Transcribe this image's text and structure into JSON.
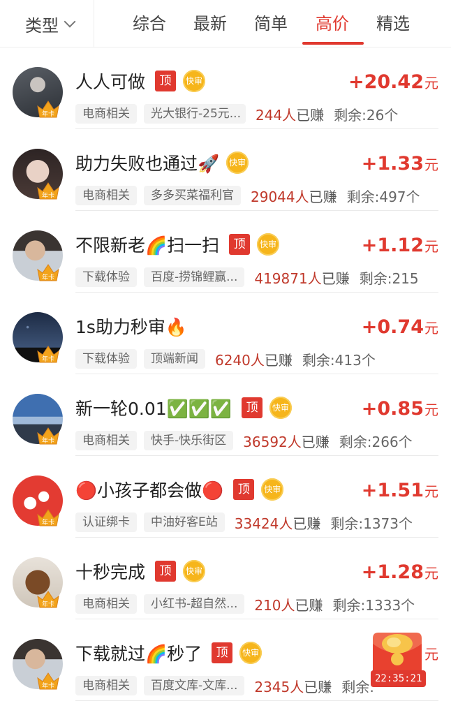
{
  "topbar": {
    "type_label": "类型",
    "tabs": [
      {
        "label": "综合"
      },
      {
        "label": "最新"
      },
      {
        "label": "简单"
      },
      {
        "label": "高价",
        "active": true
      },
      {
        "label": "精选"
      }
    ]
  },
  "accent_color": "#e0392f",
  "tasks": [
    {
      "title": "人人可做",
      "emoji": "",
      "top_badge": "顶",
      "fast_badge": "快审",
      "price": "+20.42",
      "unit": "元",
      "tag1": "电商相关",
      "tag2": "光大银行-25元...",
      "earned_count": "244人",
      "earned_suffix": "已赚",
      "remaining": "剩余:26个",
      "avatar": "person-dark-photo",
      "crown_label": "年卡"
    },
    {
      "title": "助力失败也通过🚀",
      "emoji": "",
      "top_badge": "",
      "fast_badge": "快审",
      "price": "+1.33",
      "unit": "元",
      "tag1": "电商相关",
      "tag2": "多多买菜福利官",
      "earned_count": "29044人",
      "earned_suffix": "已赚",
      "remaining": "剩余:497个",
      "avatar": "girl-photo",
      "crown_label": "年卡"
    },
    {
      "title": "不限新老🌈扫一扫",
      "emoji": "",
      "top_badge": "顶",
      "fast_badge": "快审",
      "price": "+1.12",
      "unit": "元",
      "tag1": "下载体验",
      "tag2": "百度-捞锦鲤赢...",
      "earned_count": "419871人",
      "earned_suffix": "已赚",
      "remaining": "剩余:215",
      "avatar": "boy-photo",
      "crown_label": "年卡"
    },
    {
      "title": "1s助力秒审🔥",
      "emoji": "",
      "top_badge": "",
      "fast_badge": "",
      "price": "+0.74",
      "unit": "元",
      "tag1": "下载体验",
      "tag2": "顶端新闻",
      "earned_count": "6240人",
      "earned_suffix": "已赚",
      "remaining": "剩余:413个",
      "avatar": "night-sky-photo",
      "crown_label": "年卡"
    },
    {
      "title": "新一轮0.01✅✅✅",
      "emoji": "",
      "top_badge": "顶",
      "fast_badge": "快审",
      "price": "+0.85",
      "unit": "元",
      "tag1": "电商相关",
      "tag2": "快手-快乐街区",
      "earned_count": "36592人",
      "earned_suffix": "已赚",
      "remaining": "剩余:266个",
      "avatar": "landscape-photo",
      "crown_label": "年卡"
    },
    {
      "title": "🔴小孩子都会做🔴",
      "emoji": "",
      "top_badge": "顶",
      "fast_badge": "快审",
      "price": "+1.51",
      "unit": "元",
      "tag1": "认证绑卡",
      "tag2": "中油好客E站",
      "earned_count": "33424人",
      "earned_suffix": "已赚",
      "remaining": "剩余:1373个",
      "avatar": "red-logo",
      "crown_label": "年卡"
    },
    {
      "title": "十秒完成",
      "emoji": "",
      "top_badge": "顶",
      "fast_badge": "快审",
      "price": "+1.28",
      "unit": "元",
      "tag1": "电商相关",
      "tag2": "小红书-超自然...",
      "earned_count": "210人",
      "earned_suffix": "已赚",
      "remaining": "剩余:1333个",
      "avatar": "puppy-photo",
      "crown_label": "年卡"
    },
    {
      "title": "下载就过🌈秒了",
      "emoji": "",
      "top_badge": "顶",
      "fast_badge": "快审",
      "price": "",
      "unit": "元",
      "tag1": "电商相关",
      "tag2": "百度文库-文库...",
      "earned_count": "2345人",
      "earned_suffix": "已赚",
      "remaining": "剩余:",
      "avatar": "boy-photo",
      "crown_label": "年卡"
    }
  ],
  "red_packet": {
    "timer": "22:35:21"
  }
}
